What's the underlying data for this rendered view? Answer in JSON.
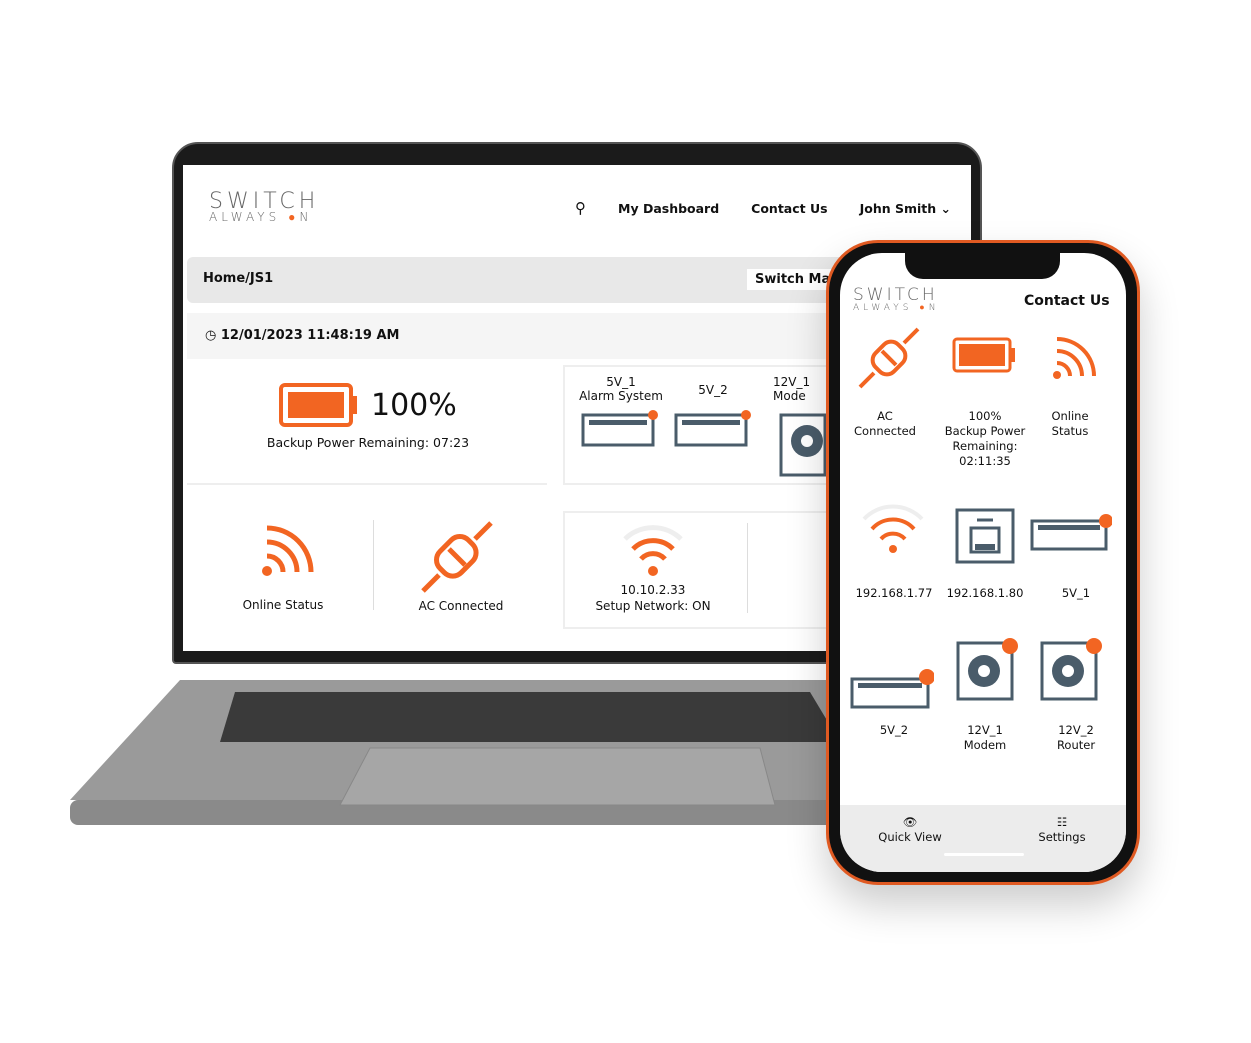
{
  "brand": {
    "line1": "SWITCH",
    "line2": "ALWAYS",
    "line2_end": "N",
    "accent": "#f26522"
  },
  "laptop": {
    "nav": {
      "dashboard": "My Dashboard",
      "contact": "Contact Us",
      "user": "John Smith"
    },
    "breadcrumb": "Home/JS1",
    "switch_button": "Switch Mai",
    "datetime": "12/01/2023 11:48:19 AM",
    "battery": {
      "percent": "100%",
      "remaining": "Backup Power Remaining: 07:23"
    },
    "ports": [
      {
        "name": "5V_1",
        "label": "Alarm System"
      },
      {
        "name": "5V_2",
        "label": ""
      },
      {
        "name": "12V_1",
        "label": "Mode"
      }
    ],
    "online": "Online Status",
    "ac": "AC Connected",
    "network": {
      "ip": "10.10.2.33",
      "status": "Setup Network: ON"
    }
  },
  "phone": {
    "contact": "Contact Us",
    "tiles": [
      {
        "l1": "AC",
        "l2": "Connected"
      },
      {
        "l1": "100%",
        "l2": "Backup Power",
        "l3": "Remaining:",
        "l4": "02:11:35"
      },
      {
        "l1": "Online",
        "l2": "Status"
      },
      {
        "l1": "192.168.1.77"
      },
      {
        "l1": "192.168.1.80"
      },
      {
        "l1": "5V_1"
      },
      {
        "l1": "5V_2"
      },
      {
        "l1": "12V_1",
        "l2": "Modem"
      },
      {
        "l1": "12V_2",
        "l2": "Router"
      }
    ],
    "tabs": {
      "quick": "Quick View",
      "settings": "Settings"
    }
  }
}
